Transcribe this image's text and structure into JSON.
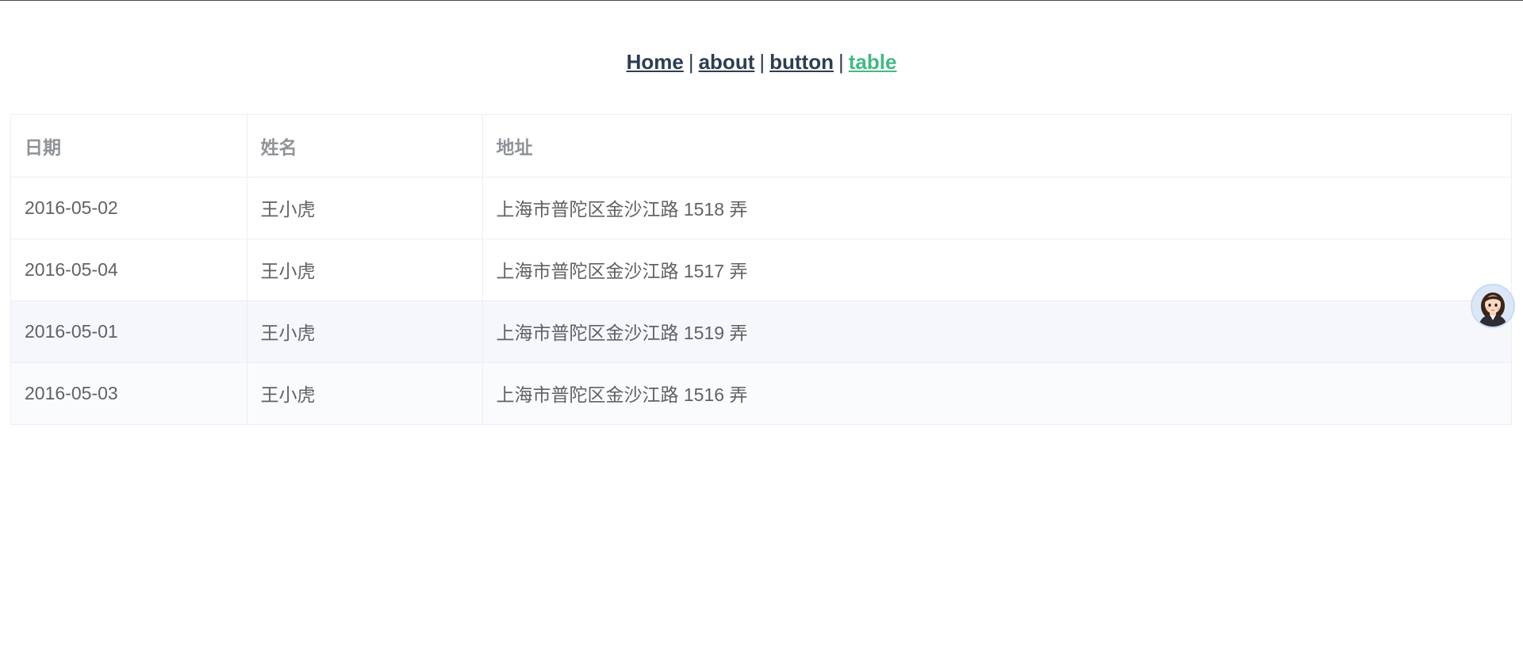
{
  "nav": {
    "links": [
      {
        "label": "Home"
      },
      {
        "label": "about"
      },
      {
        "label": "button"
      },
      {
        "label": "table"
      }
    ],
    "separator": "|",
    "active": "table",
    "active_color": "#42b983",
    "link_color": "#2c3e50"
  },
  "table": {
    "headers": [
      "日期",
      "姓名",
      "地址"
    ],
    "rows": [
      [
        "2016-05-02",
        "王小虎",
        "上海市普陀区金沙江路 1518 弄"
      ],
      [
        "2016-05-04",
        "王小虎",
        "上海市普陀区金沙江路 1517 弄"
      ],
      [
        "2016-05-01",
        "王小虎",
        "上海市普陀区金沙江路 1519 弄"
      ],
      [
        "2016-05-03",
        "王小虎",
        "上海市普陀区金沙江路 1516 弄"
      ]
    ],
    "header_color": "#909399",
    "cell_color": "#606266",
    "striped_row_color": "#f5f7fa"
  },
  "assistant": {
    "icon": "assistant-avatar-icon"
  }
}
